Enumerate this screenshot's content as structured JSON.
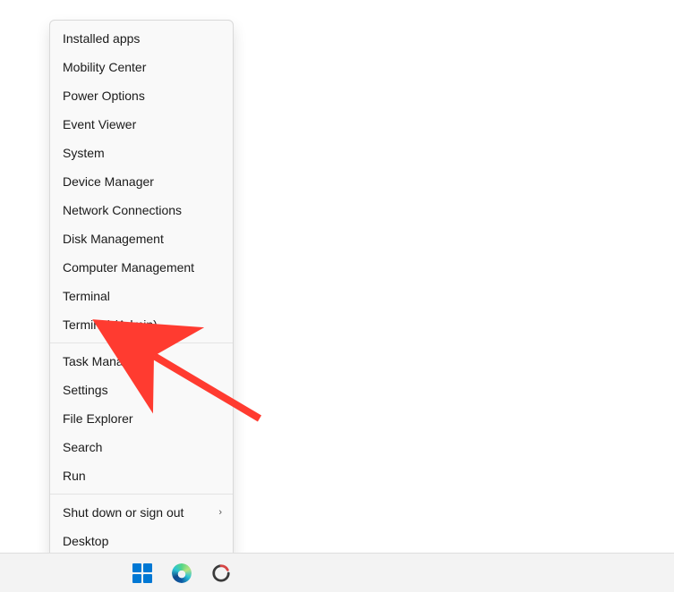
{
  "context_menu": {
    "groups": [
      [
        {
          "id": "installed-apps",
          "label": "Installed apps"
        },
        {
          "id": "mobility-center",
          "label": "Mobility Center"
        },
        {
          "id": "power-options",
          "label": "Power Options"
        },
        {
          "id": "event-viewer",
          "label": "Event Viewer"
        },
        {
          "id": "system",
          "label": "System"
        },
        {
          "id": "device-manager",
          "label": "Device Manager"
        },
        {
          "id": "network-connections",
          "label": "Network Connections"
        },
        {
          "id": "disk-management",
          "label": "Disk Management"
        },
        {
          "id": "computer-management",
          "label": "Computer Management"
        },
        {
          "id": "terminal",
          "label": "Terminal"
        },
        {
          "id": "terminal-admin",
          "label": "Terminal (Admin)"
        }
      ],
      [
        {
          "id": "task-manager",
          "label": "Task Manager"
        },
        {
          "id": "settings",
          "label": "Settings"
        },
        {
          "id": "file-explorer",
          "label": "File Explorer"
        },
        {
          "id": "search",
          "label": "Search"
        },
        {
          "id": "run",
          "label": "Run"
        }
      ],
      [
        {
          "id": "shut-down",
          "label": "Shut down or sign out",
          "submenu": true
        },
        {
          "id": "desktop",
          "label": "Desktop"
        }
      ]
    ]
  },
  "taskbar": {
    "apps": [
      {
        "id": "start",
        "name": "start-button"
      },
      {
        "id": "edge",
        "name": "edge-icon"
      },
      {
        "id": "app3",
        "name": "pinned-app-icon"
      }
    ]
  },
  "annotation": {
    "points_to": "task-manager",
    "color": "#ff3b30"
  }
}
